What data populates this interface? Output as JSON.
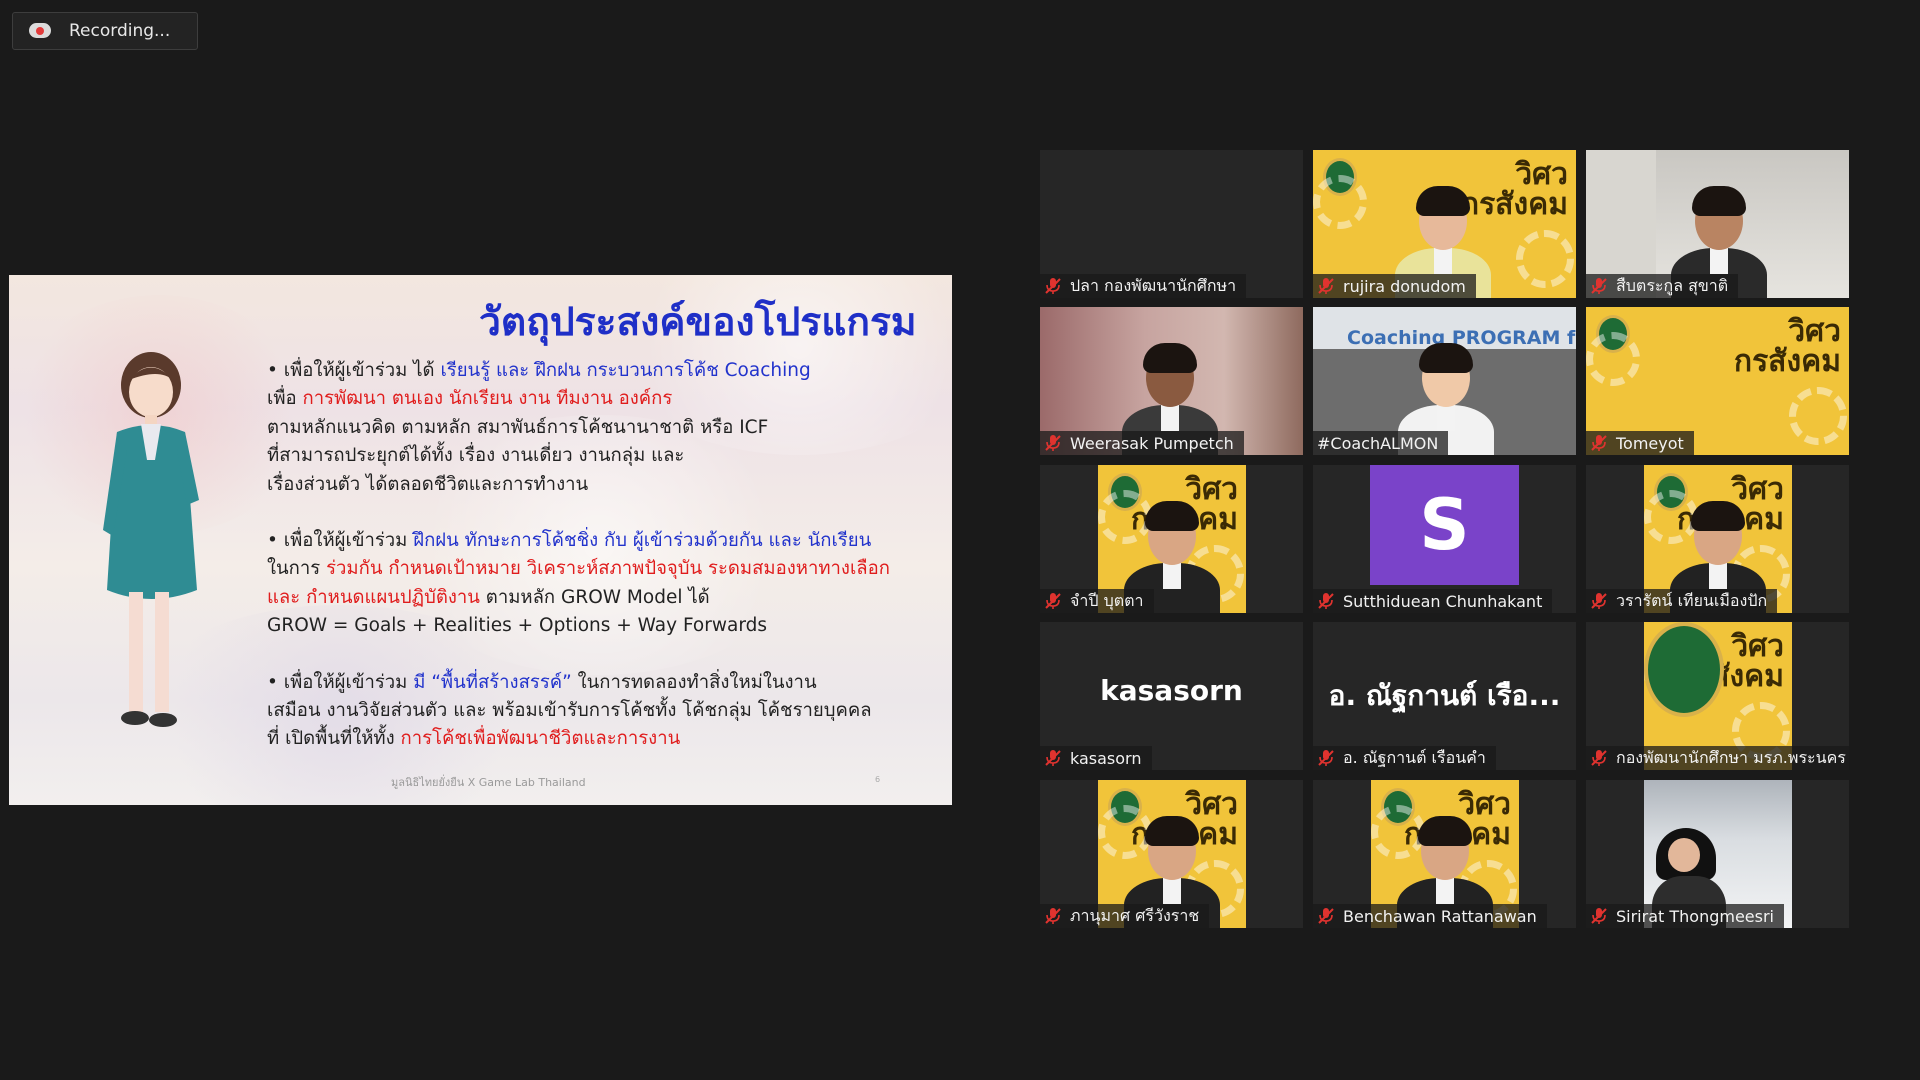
{
  "recording": {
    "label": "Recording..."
  },
  "slide": {
    "title": "วัตถุประสงค์ของโปรแกรม",
    "p1": {
      "l1a": "• เพื่อให้ผู้เข้าร่วม ได้ ",
      "l1b": "เรียนรู้ และ ฝึกฝน กระบวนการโค้ช Coaching",
      "l2a": "เพื่อ ",
      "l2b": "การพัฒนา ตนเอง นักเรียน งาน ทีมงาน องค์กร",
      "l3": "ตามหลักแนวคิด ตามหลัก สมาพันธ์การโค้ชนานาชาติ หรือ ICF",
      "l4": "ที่สามารถประยุกต์ได้ทั้ง เรื่อง งานเดี่ยว งานกลุ่ม และ",
      "l5": "เรื่องส่วนตัว ได้ตลอดชีวิตและการทำงาน"
    },
    "p2": {
      "l1a": "• เพื่อให้ผู้เข้าร่วม ",
      "l1b": "ฝึกฝน ทักษะการโค้ชชิ่ง กับ ผู้เข้าร่วมด้วยกัน และ นักเรียน",
      "l2a": "ในการ ",
      "l2b": "ร่วมกัน กำหนดเป้าหมาย วิเคราะห์สภาพปัจจุบัน ระดมสมองหาทางเลือก",
      "l3a": "และ กำหนดแผนปฏิบัติงาน",
      "l3b": " ตามหลัก GROW Model ได้",
      "l4": "GROW = Goals + Realities + Options + Way Forwards"
    },
    "p3": {
      "l1a": "• เพื่อให้ผู้เข้าร่วม ",
      "l1b": "มี “พื้นที่สร้างสรรค์”",
      "l1c": " ในการทดลองทำสิ่งใหม่ในงาน",
      "l2": "เสมือน งานวิจัยส่วนตัว และ พร้อมเข้ารับการโค้ชทั้ง โค้ชกลุ่ม โค้ชรายบุคคล",
      "l3a": "ที่ เปิดพื้นที่ให้ทั้ง ",
      "l3b": "การโค้ชเพื่อพัฒนาชีวิตและการงาน"
    },
    "footer": "มูลนิธิไทยยั่งยืน X Game Lab Thailand",
    "page_number": "6"
  },
  "participants": [
    {
      "name": "ปลา กองพัฒนานักศึกษา",
      "kind": "blank",
      "muted": true
    },
    {
      "name": "rujira donudom",
      "kind": "yellow-woman",
      "muted": true
    },
    {
      "name": "สืบตระกูล สุขาติ",
      "kind": "man-office",
      "muted": true
    },
    {
      "name": "Weerasak Pumpetch",
      "kind": "man-room",
      "muted": true
    },
    {
      "name": "#CoachALMON",
      "kind": "presenter",
      "muted": false,
      "active": true,
      "banner": "Coaching PROGRAM for Teacher"
    },
    {
      "name": "Tomeyot",
      "kind": "yellow-empty",
      "muted": true
    },
    {
      "name": "จำปี บุตตา",
      "kind": "yellow-portrait",
      "muted": true
    },
    {
      "name": "Sutthiduean Chunhakant",
      "kind": "avatar",
      "avatar_letter": "S",
      "muted": true
    },
    {
      "name": "วรารัตน์ เทียนเมืองปัก",
      "kind": "yellow-portrait",
      "muted": true
    },
    {
      "name": "kasasorn",
      "kind": "text-name",
      "display_name": "kasasorn",
      "muted": true
    },
    {
      "name": "อ. ณัฐกานต์ เรือนคำ",
      "kind": "text-name",
      "display_name": "อ. ณัฐกานต์ เรือ...",
      "muted": true
    },
    {
      "name": "กองพัฒนานักศึกษา มรภ.พระนคร",
      "kind": "yellow-logo",
      "muted": true
    },
    {
      "name": "ภานุมาศ ศรีวังราช",
      "kind": "yellow-portrait",
      "muted": true
    },
    {
      "name": "Benchawan Rattanawan",
      "kind": "yellow-portrait",
      "muted": true
    },
    {
      "name": "Sirirat Thongmeesri",
      "kind": "snow",
      "muted": true
    }
  ],
  "brand_text": "วิศวกรสังคม",
  "colors": {
    "accent": "#f2e04a",
    "muted_icon": "#e0332f",
    "slide_title": "#1f2fc7",
    "slide_red": "#e01d1d"
  }
}
